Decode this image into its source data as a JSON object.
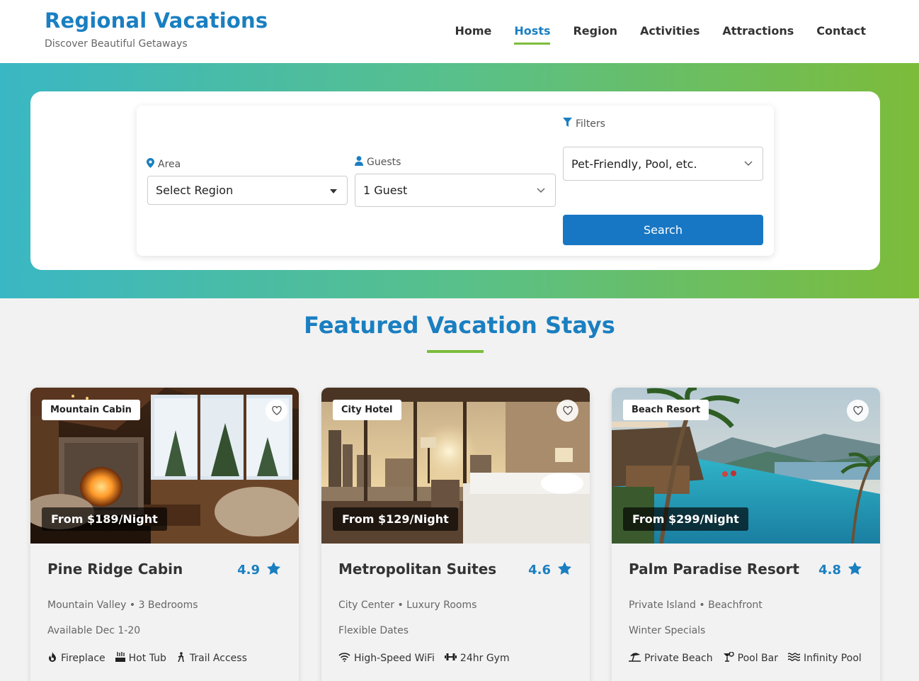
{
  "header": {
    "title": "Regional Vacations",
    "subtitle": "Discover Beautiful Getaways",
    "nav": [
      {
        "label": "Home",
        "active": false
      },
      {
        "label": "Hosts",
        "active": true
      },
      {
        "label": "Region",
        "active": false
      },
      {
        "label": "Activities",
        "active": false
      },
      {
        "label": "Attractions",
        "active": false
      },
      {
        "label": "Contact",
        "active": false
      }
    ]
  },
  "search": {
    "area_label": "Area",
    "area_value": "Select Region",
    "guests_label": "Guests",
    "guests_value": "1 Guest",
    "filters_label": "Filters",
    "filters_value": "Pet-Friendly, Pool, etc.",
    "button_label": "Search"
  },
  "featured": {
    "title": "Featured Vacation Stays",
    "cards": [
      {
        "badge": "Mountain Cabin",
        "price": "From $189/Night",
        "name": "Pine Ridge Cabin",
        "rating": "4.9",
        "meta1": "Mountain Valley • 3 Bedrooms",
        "meta2": "Available Dec 1-20",
        "amenities": [
          "Fireplace",
          "Hot Tub",
          "Trail Access"
        ],
        "amenity_icons": [
          "fire-icon",
          "hot-tub-icon",
          "hiking-icon"
        ]
      },
      {
        "badge": "City Hotel",
        "price": "From $129/Night",
        "name": "Metropolitan Suites",
        "rating": "4.6",
        "meta1": "City Center • Luxury Rooms",
        "meta2": "Flexible Dates",
        "amenities": [
          "High-Speed WiFi",
          "24hr Gym"
        ],
        "amenity_icons": [
          "wifi-icon",
          "dumbbell-icon"
        ]
      },
      {
        "badge": "Beach Resort",
        "price": "From $299/Night",
        "name": "Palm Paradise Resort",
        "rating": "4.8",
        "meta1": "Private Island • Beachfront",
        "meta2": "Winter Specials",
        "amenities": [
          "Private Beach",
          "Pool Bar",
          "Infinity Pool"
        ],
        "amenity_icons": [
          "umbrella-beach-icon",
          "cocktail-icon",
          "water-icon"
        ]
      }
    ]
  },
  "colors": {
    "brand": "#1a7fc1",
    "accent": "#7cbd3b",
    "button": "#1877c4"
  }
}
